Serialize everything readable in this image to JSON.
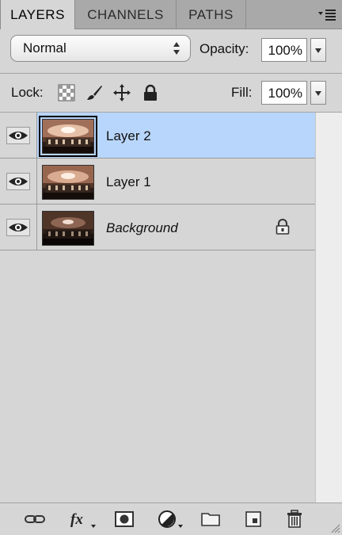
{
  "tabs": [
    {
      "label": "LAYERS",
      "active": true
    },
    {
      "label": "CHANNELS",
      "active": false
    },
    {
      "label": "PATHS",
      "active": false
    }
  ],
  "blend_mode": {
    "value": "Normal"
  },
  "opacity": {
    "label": "Opacity:",
    "value": "100%"
  },
  "lock": {
    "label": "Lock:",
    "icons": [
      "lock-transparent-pixels-icon",
      "lock-image-pixels-icon",
      "lock-position-icon",
      "lock-all-icon"
    ]
  },
  "fill": {
    "label": "Fill:",
    "value": "100%"
  },
  "layers": [
    {
      "name": "Layer 2",
      "visible": true,
      "selected": true,
      "locked": false
    },
    {
      "name": "Layer 1",
      "visible": true,
      "selected": false,
      "locked": false
    },
    {
      "name": "Background",
      "visible": true,
      "selected": false,
      "locked": true
    }
  ],
  "bottom_icons": [
    "link-layers-icon",
    "layer-style-fx-icon",
    "layer-mask-icon",
    "adjustment-layer-icon",
    "new-group-folder-icon",
    "new-layer-icon",
    "delete-trash-icon"
  ],
  "colors": {
    "selection": "#b8d6fb",
    "panel": "#d6d6d6",
    "tabbar": "#a9a9a9"
  }
}
